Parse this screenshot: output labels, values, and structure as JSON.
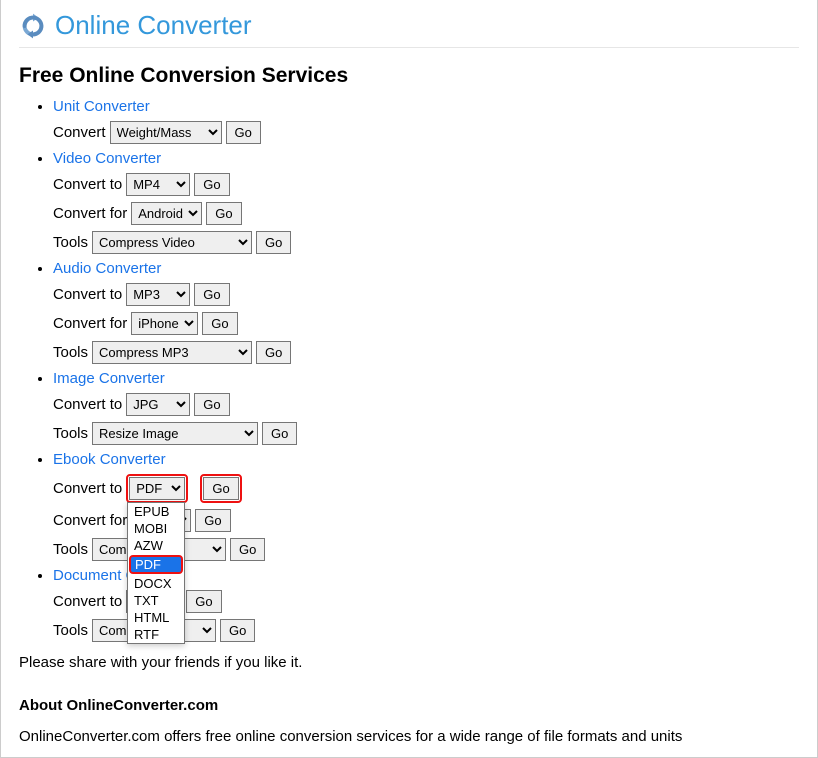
{
  "brand": {
    "name": "Online Converter"
  },
  "heading": "Free Online Conversion Services",
  "go_label": "Go",
  "labels": {
    "convert": "Convert",
    "convert_to": "Convert to",
    "convert_for": "Convert for",
    "tools": "Tools"
  },
  "sections": {
    "unit": {
      "title": "Unit Converter",
      "convert_value": "Weight/Mass"
    },
    "video": {
      "title": "Video Converter",
      "convert_to_value": "MP4",
      "convert_for_value": "Android",
      "tools_value": "Compress Video"
    },
    "audio": {
      "title": "Audio Converter",
      "convert_to_value": "MP3",
      "convert_for_value": "iPhone",
      "tools_value": "Compress MP3"
    },
    "image": {
      "title": "Image Converter",
      "convert_to_value": "JPG",
      "tools_value": "Resize Image"
    },
    "ebook": {
      "title": "Ebook Converter",
      "convert_to_value": "PDF",
      "convert_to_options": [
        "EPUB",
        "MOBI",
        "AZW",
        "PDF",
        "DOCX",
        "TXT",
        "HTML",
        "RTF"
      ],
      "convert_for_value": "",
      "tools_value": "Com                 3"
    },
    "document": {
      "title": "Document C",
      "convert_to_value": "",
      "tools_value": "Com"
    }
  },
  "share_line": "Please share with your friends if you like it.",
  "about": {
    "title": "About OnlineConverter.com",
    "body": "OnlineConverter.com offers free online conversion services for a wide range of file formats and units"
  }
}
